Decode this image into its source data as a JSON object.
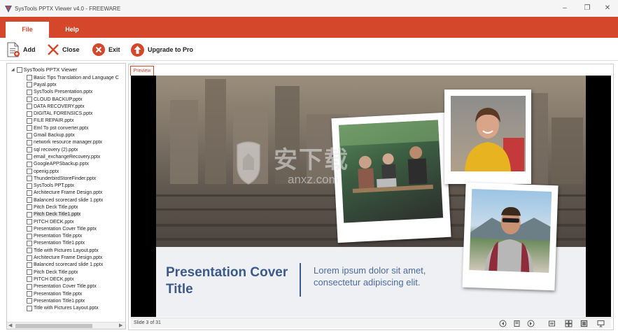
{
  "window": {
    "title": "SysTools PPTX Viewer v4.0 - FREEWARE",
    "controls": [
      "–",
      "❐",
      "✕"
    ]
  },
  "ribbon": {
    "tabs": [
      {
        "label": "File",
        "active": true
      },
      {
        "label": "Help",
        "active": false
      }
    ]
  },
  "toolbar": {
    "add_label": "Add",
    "close_label": "Close",
    "exit_label": "Exit",
    "upgrade_label": "Upgrade to Pro"
  },
  "tree": {
    "root_label": "SysTools PPTX Viewer",
    "files": [
      "Basic Tips Translation and Language C",
      "Payal.pptx",
      "SysTools Presentation.pptx",
      "CLOUD BACKUP.pptx",
      "DATA RECOVERY.pptx",
      "DIGITAL FORENSICS.pptx",
      "FILE REPAIR.pptx",
      "Eml To pst converter.pptx",
      "Gmail Backup.pptx",
      "network resource manager.pptx",
      "sql recovery (2).pptx",
      "email_exchangeRecovery.pptx",
      "GoogleAPPSbackup.pptx",
      "openig.pptx",
      "ThunderbirdStoreFinder.pptx",
      "SysTools PPT.pptx",
      "Architecture Frame Design.pptx",
      "Balanced scorecard slide 1.pptx",
      "Pitch Deck Title.pptx",
      "Pitch Deck Title1.pptx",
      "PITCH DECK.pptx",
      "Presentation Cover Title.pptx",
      "Presentation Title.pptx",
      "Presentation Title1.pptx",
      "Title with Pictures Layout.pptx",
      "Architecture Frame Design.pptx",
      "Balanced scorecard slide 1.pptx",
      "Pitch Deck Title.pptx",
      "PITCH DECK.pptx",
      "Presentation Cover Title.pptx",
      "Presentation Title.pptx",
      "Presentation Title1.pptx",
      "Title with Pictures Layout.pptx"
    ],
    "selected_index": 19
  },
  "preview": {
    "tab_label": "Preview",
    "slide": {
      "title": "Presentation Cover Title",
      "body": "Lorem ipsum dolor sit amet, consectetur adipiscing elit."
    },
    "status": "Slide 3 of 31"
  },
  "watermark": {
    "text": "安下载",
    "sub": "anxz.com"
  },
  "colors": {
    "accent": "#d4472a",
    "slide_title": "#3b5a8a"
  }
}
